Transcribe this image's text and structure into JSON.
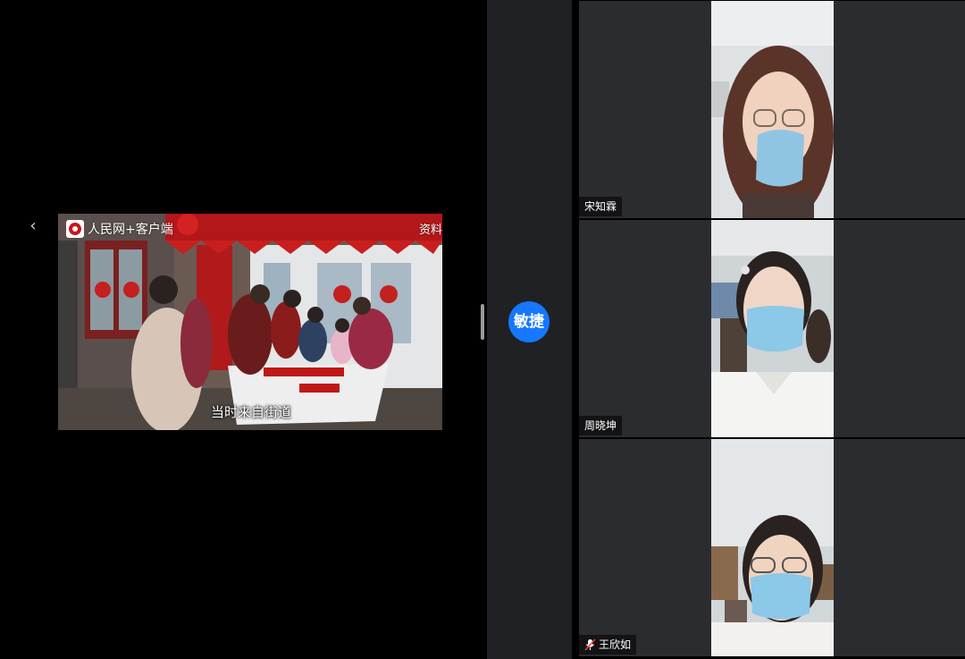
{
  "share": {
    "back_icon": "chevron-left-icon",
    "video": {
      "brand": "人民网+客户端",
      "tag": "资料",
      "subtitle": "当时来自街道"
    }
  },
  "presenter": {
    "avatar_text": "敏捷",
    "avatar_color": "#1677ff"
  },
  "participants": [
    {
      "name": "宋知霖",
      "muted": false
    },
    {
      "name": "周晓坤",
      "muted": false
    },
    {
      "name": "王欣如",
      "muted": true
    }
  ]
}
